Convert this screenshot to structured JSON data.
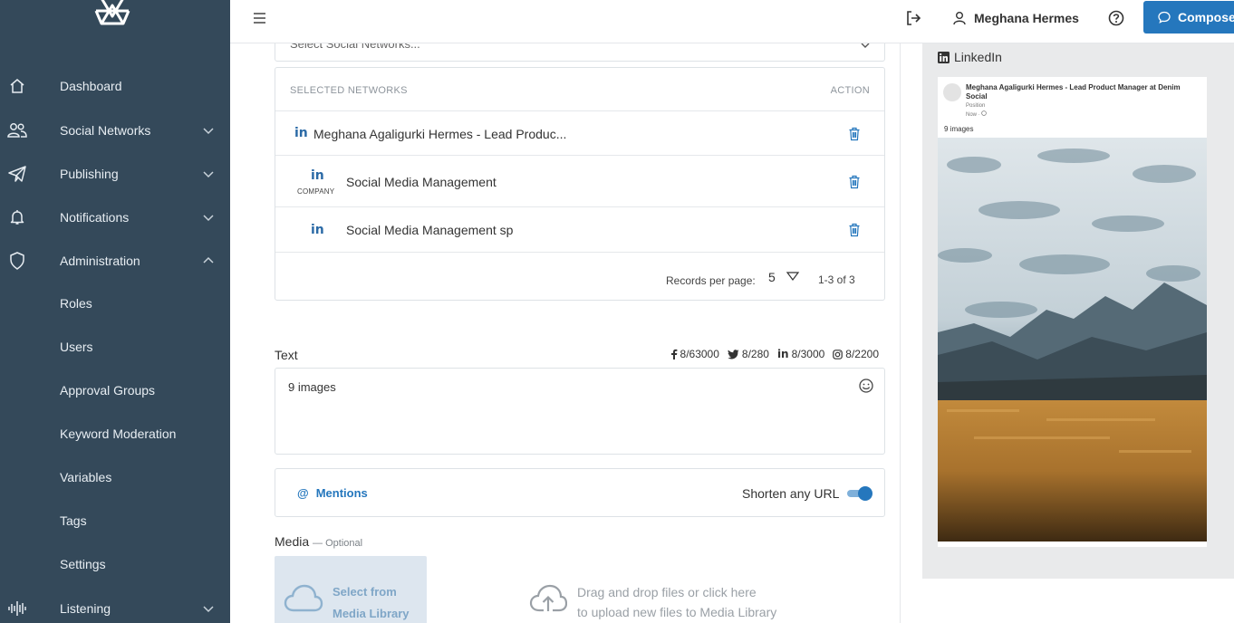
{
  "sidebar": {
    "items": [
      {
        "label": "Dashboard",
        "icon": "home-icon"
      },
      {
        "label": "Social Networks",
        "icon": "users-icon"
      },
      {
        "label": "Publishing",
        "icon": "paper-plane-icon"
      },
      {
        "label": "Notifications",
        "icon": "bell-icon"
      },
      {
        "label": "Administration",
        "icon": "shield-icon"
      }
    ],
    "subitems": [
      "Roles",
      "Users",
      "Approval Groups",
      "Keyword Moderation",
      "Variables",
      "Tags",
      "Settings"
    ],
    "listening": {
      "label": "Listening",
      "icon": "sound-wave-icon"
    }
  },
  "topbar": {
    "user_name": "Meghana Hermes",
    "compose_label": "Compose"
  },
  "networks": {
    "select_placeholder": "Select Social Networks...",
    "header_networks": "SELECTED NETWORKS",
    "header_action": "ACTION",
    "rows": [
      {
        "name": "Meghana Agaligurki Hermes - Lead Produc...",
        "type": ""
      },
      {
        "name": "Social Media Management",
        "type": "COMPANY"
      },
      {
        "name": "Social Media Management sp",
        "type": ""
      }
    ],
    "linkedin_glyph": "in",
    "records_per_page_label": "Records per page:",
    "records_per_page": "5",
    "range": "1-3 of 3"
  },
  "composer": {
    "text_label": "Text",
    "counts": {
      "facebook": "8/63000",
      "twitter": "8/280",
      "linkedin": "8/3000",
      "instagram": "8/2200"
    },
    "text_value": "9 images",
    "mentions_label": "Mentions",
    "shorten_label": "Shorten any URL",
    "shorten_enabled": true,
    "media_label": "Media",
    "media_optional": "— Optional",
    "media_library_line1": "Select from",
    "media_library_line2": "Media Library",
    "upload_line1": "Drag and drop files or click here",
    "upload_line2": "to upload new files to Media Library"
  },
  "preview": {
    "network": "LinkedIn",
    "author": "Meghana Agaligurki Hermes - Lead Product Manager at Denim Social",
    "position": "Position",
    "time": "Now ·",
    "text": "9 images"
  },
  "colors": {
    "sidebar_bg": "#34495a",
    "accent": "#2577bd",
    "linkedin": "#2b6aa6"
  }
}
